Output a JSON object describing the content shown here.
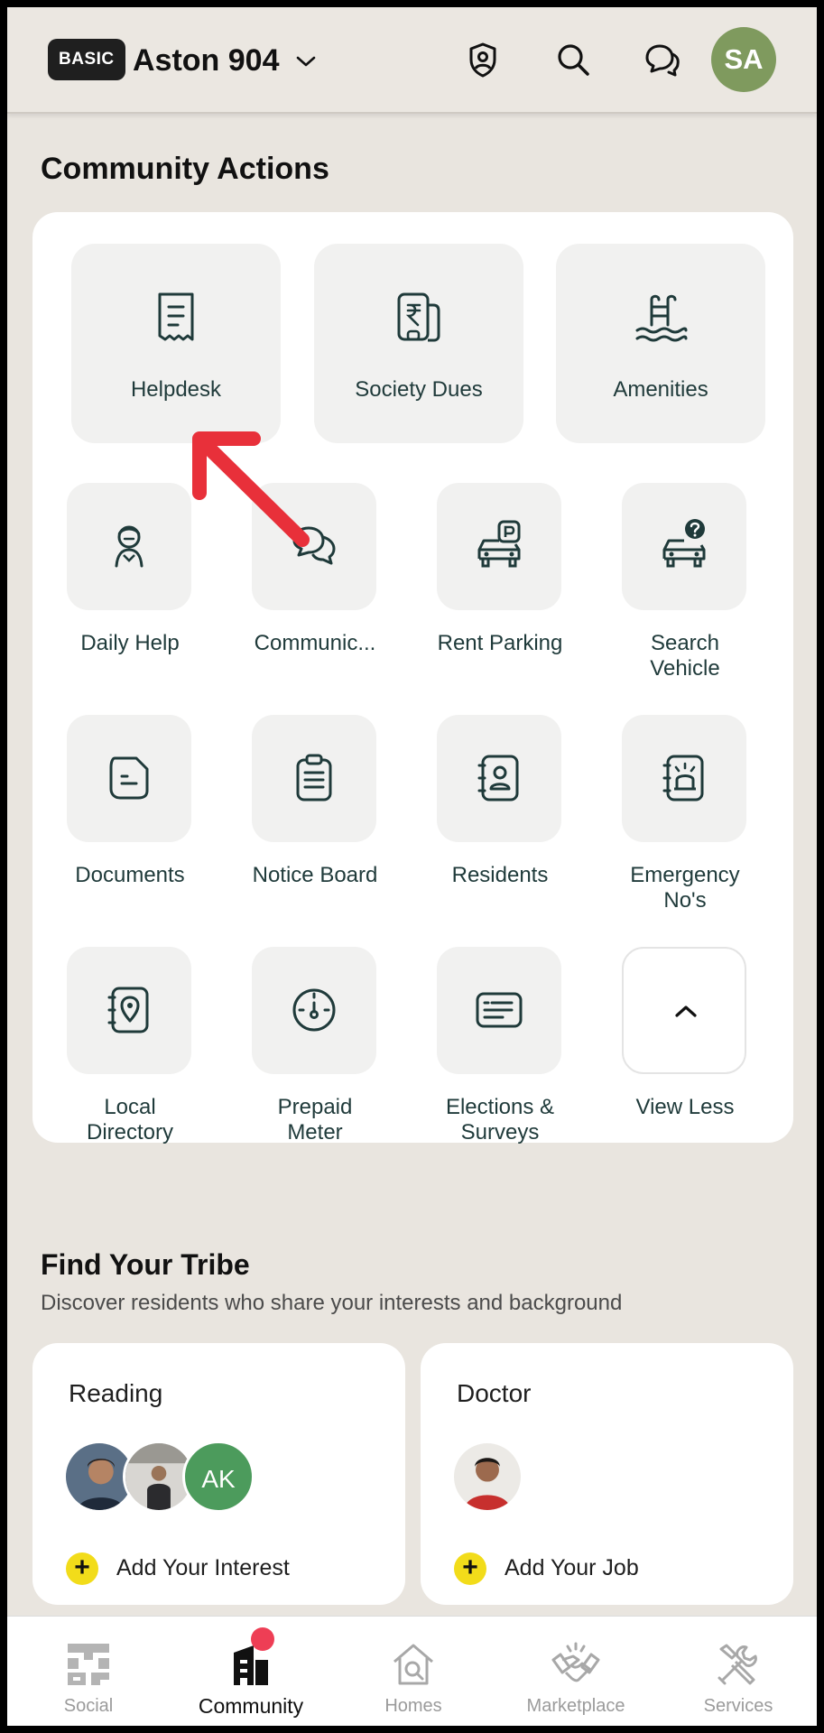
{
  "header": {
    "plan_badge": "BASIC",
    "unit_name": "Aston 904",
    "avatar_initials": "SA",
    "avatar_color": "#7f9a5e",
    "icons": [
      "shield-icon",
      "search-icon",
      "chat-icon"
    ]
  },
  "community_actions": {
    "title": "Community Actions",
    "primary": [
      {
        "label": "Helpdesk",
        "icon": "receipt-icon"
      },
      {
        "label": "Society Dues",
        "icon": "rupee-phone-icon"
      },
      {
        "label": "Amenities",
        "icon": "pool-ladder-icon"
      }
    ],
    "items": [
      {
        "label": "Daily Help",
        "icon": "maid-icon"
      },
      {
        "label": "Communic...",
        "icon": "chat-bubbles-icon"
      },
      {
        "label": "Rent Parking",
        "icon": "car-parking-icon"
      },
      {
        "label": "Search Vehicle",
        "icon": "car-question-icon"
      },
      {
        "label": "Documents",
        "icon": "document-icon"
      },
      {
        "label": "Notice Board",
        "icon": "clipboard-icon"
      },
      {
        "label": "Residents",
        "icon": "contact-book-icon"
      },
      {
        "label": "Emergency No's",
        "icon": "siren-icon"
      },
      {
        "label": "Local Directory",
        "icon": "location-book-icon"
      },
      {
        "label": "Prepaid Meter",
        "icon": "meter-icon"
      },
      {
        "label": "Elections & Surveys",
        "icon": "ballot-card-icon"
      },
      {
        "label": "View Less",
        "icon": "chevron-up-icon"
      }
    ]
  },
  "tribe": {
    "title": "Find Your Tribe",
    "subtitle": "Discover residents who share your interests and background",
    "cards": [
      {
        "name": "Reading",
        "member_initials": "AK",
        "add_label": "Add Your Interest"
      },
      {
        "name": "Doctor",
        "add_label": "Add Your Job"
      }
    ]
  },
  "bottom_nav": {
    "items": [
      {
        "label": "Social",
        "icon": "social-icon"
      },
      {
        "label": "Community",
        "icon": "community-building-icon",
        "active": true
      },
      {
        "label": "Homes",
        "icon": "home-search-icon"
      },
      {
        "label": "Marketplace",
        "icon": "handshake-icon"
      },
      {
        "label": "Services",
        "icon": "tools-icon"
      }
    ]
  },
  "colors": {
    "background": "#e9e5df",
    "card": "#ffffff",
    "tile": "#f1f1f0",
    "icon_stroke": "#1f3a3a",
    "accent_yellow": "#f2dc1a",
    "notification_red": "#ee3e55",
    "annotation_arrow": "#e8303a"
  }
}
